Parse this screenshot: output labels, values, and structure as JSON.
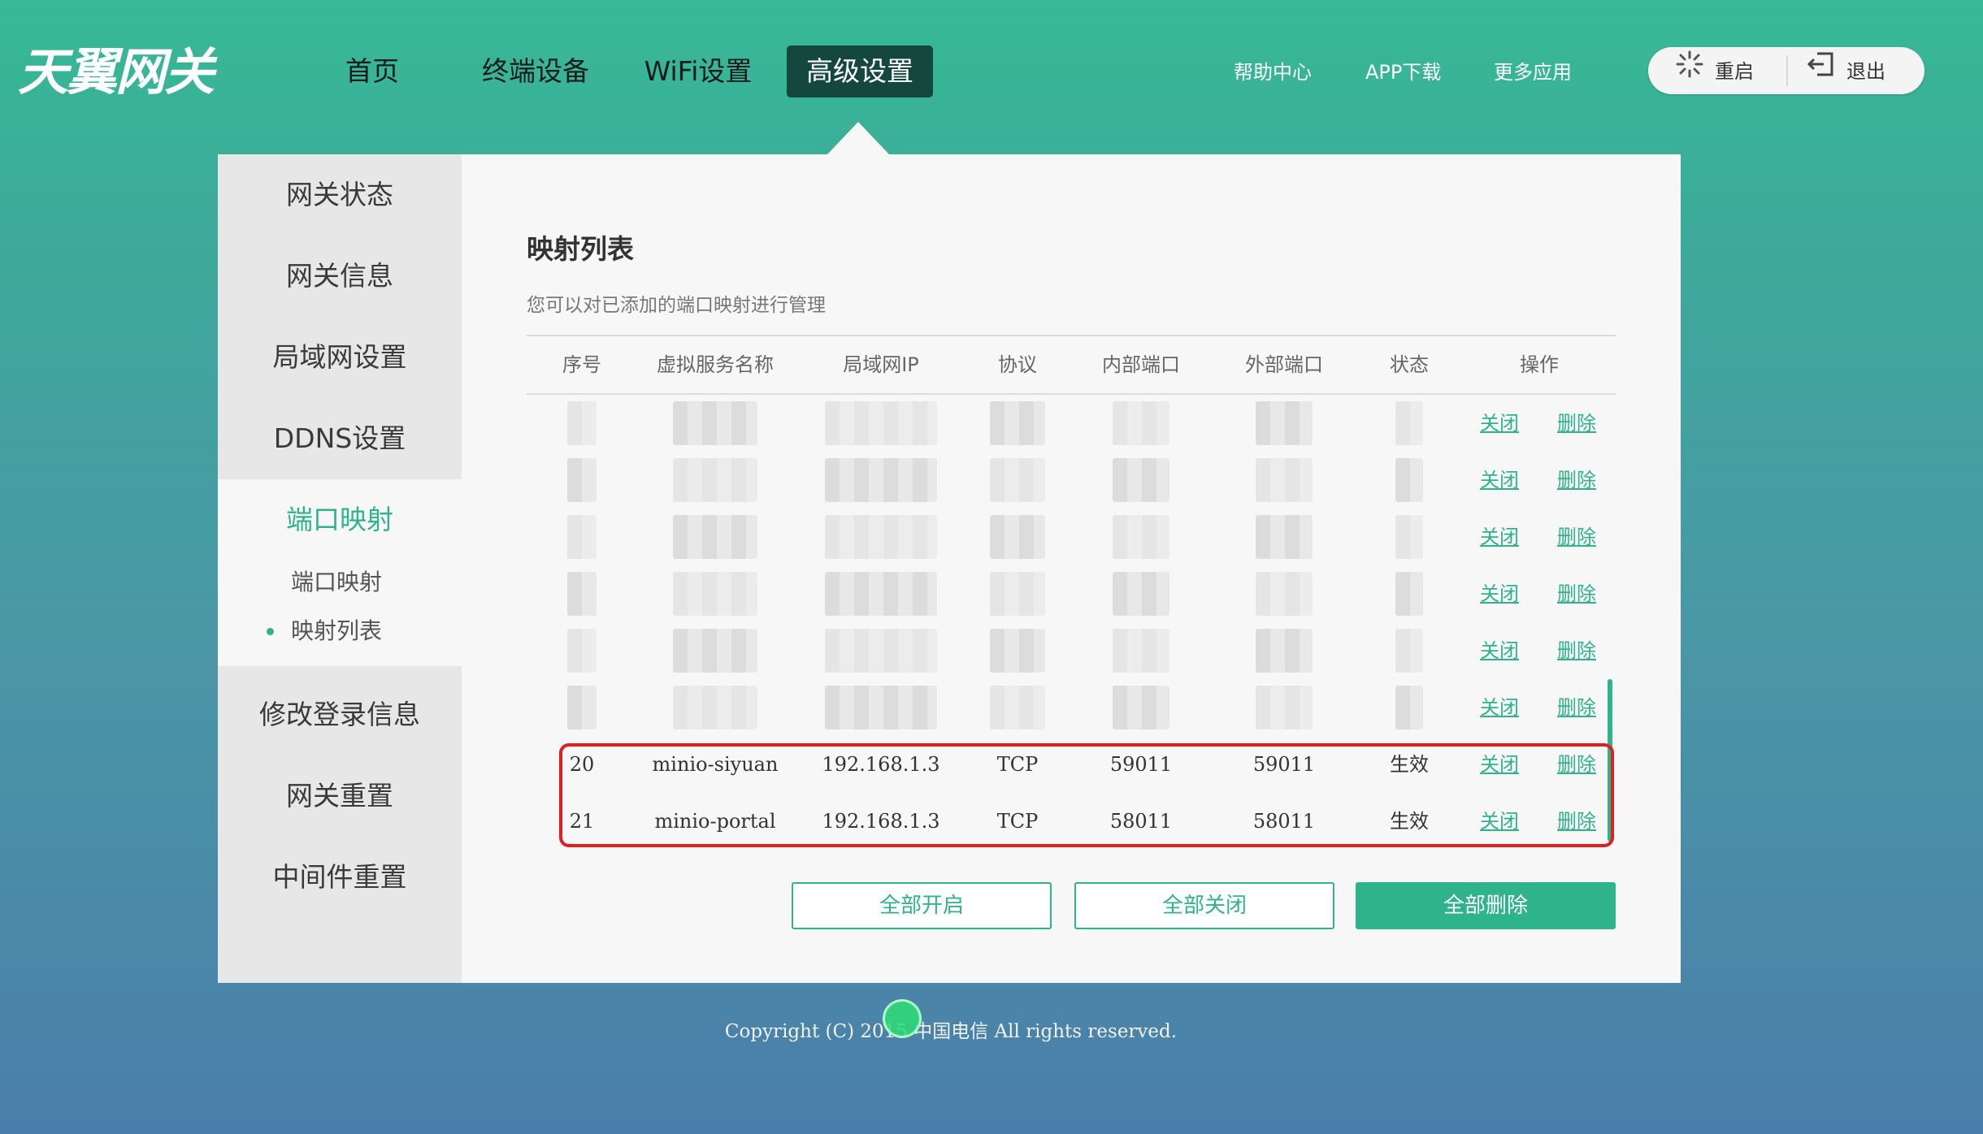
{
  "brand": {
    "logo_text": "天翼网关"
  },
  "nav": {
    "items": [
      {
        "label": "首页",
        "active": false
      },
      {
        "label": "终端设备",
        "active": false
      },
      {
        "label": "WiFi设置",
        "active": false
      },
      {
        "label": "高级设置",
        "active": true
      }
    ]
  },
  "top_links": [
    "帮助中心",
    "APP下载",
    "更多应用"
  ],
  "top_actions": {
    "restart_label": "重启",
    "logout_label": "退出"
  },
  "sidebar": {
    "items": [
      "网关状态",
      "网关信息",
      "局域网设置",
      "DDNS设置"
    ],
    "active_group": {
      "label": "端口映射",
      "subitems": [
        {
          "label": "端口映射",
          "active": false
        },
        {
          "label": "映射列表",
          "active": true
        }
      ]
    },
    "items_after": [
      "修改登录信息",
      "网关重置",
      "中间件重置"
    ]
  },
  "main": {
    "title": "映射列表",
    "description": "您可以对已添加的端口映射进行管理",
    "table": {
      "headers": [
        "序号",
        "虚拟服务名称",
        "局域网IP",
        "协议",
        "内部端口",
        "外部端口",
        "状态",
        "操作"
      ],
      "blurred_row_count": 6,
      "action_close": "关闭",
      "action_delete": "删除",
      "rows": [
        {
          "id": "20",
          "name": "minio-siyuan",
          "ip": "192.168.1.3",
          "protocol": "TCP",
          "internal_port": "59011",
          "external_port": "59011",
          "status": "生效"
        },
        {
          "id": "21",
          "name": "minio-portal",
          "ip": "192.168.1.3",
          "protocol": "TCP",
          "internal_port": "58011",
          "external_port": "58011",
          "status": "生效"
        }
      ]
    },
    "buttons": {
      "enable_all": "全部开启",
      "disable_all": "全部关闭",
      "delete_all": "全部删除"
    }
  },
  "footer": {
    "copyright": "Copyright (C) 2015 中国电信 All rights reserved."
  },
  "colors": {
    "accent": "#2fb38a",
    "nav_active_bg": "#14483f",
    "highlight": "#e02020"
  }
}
